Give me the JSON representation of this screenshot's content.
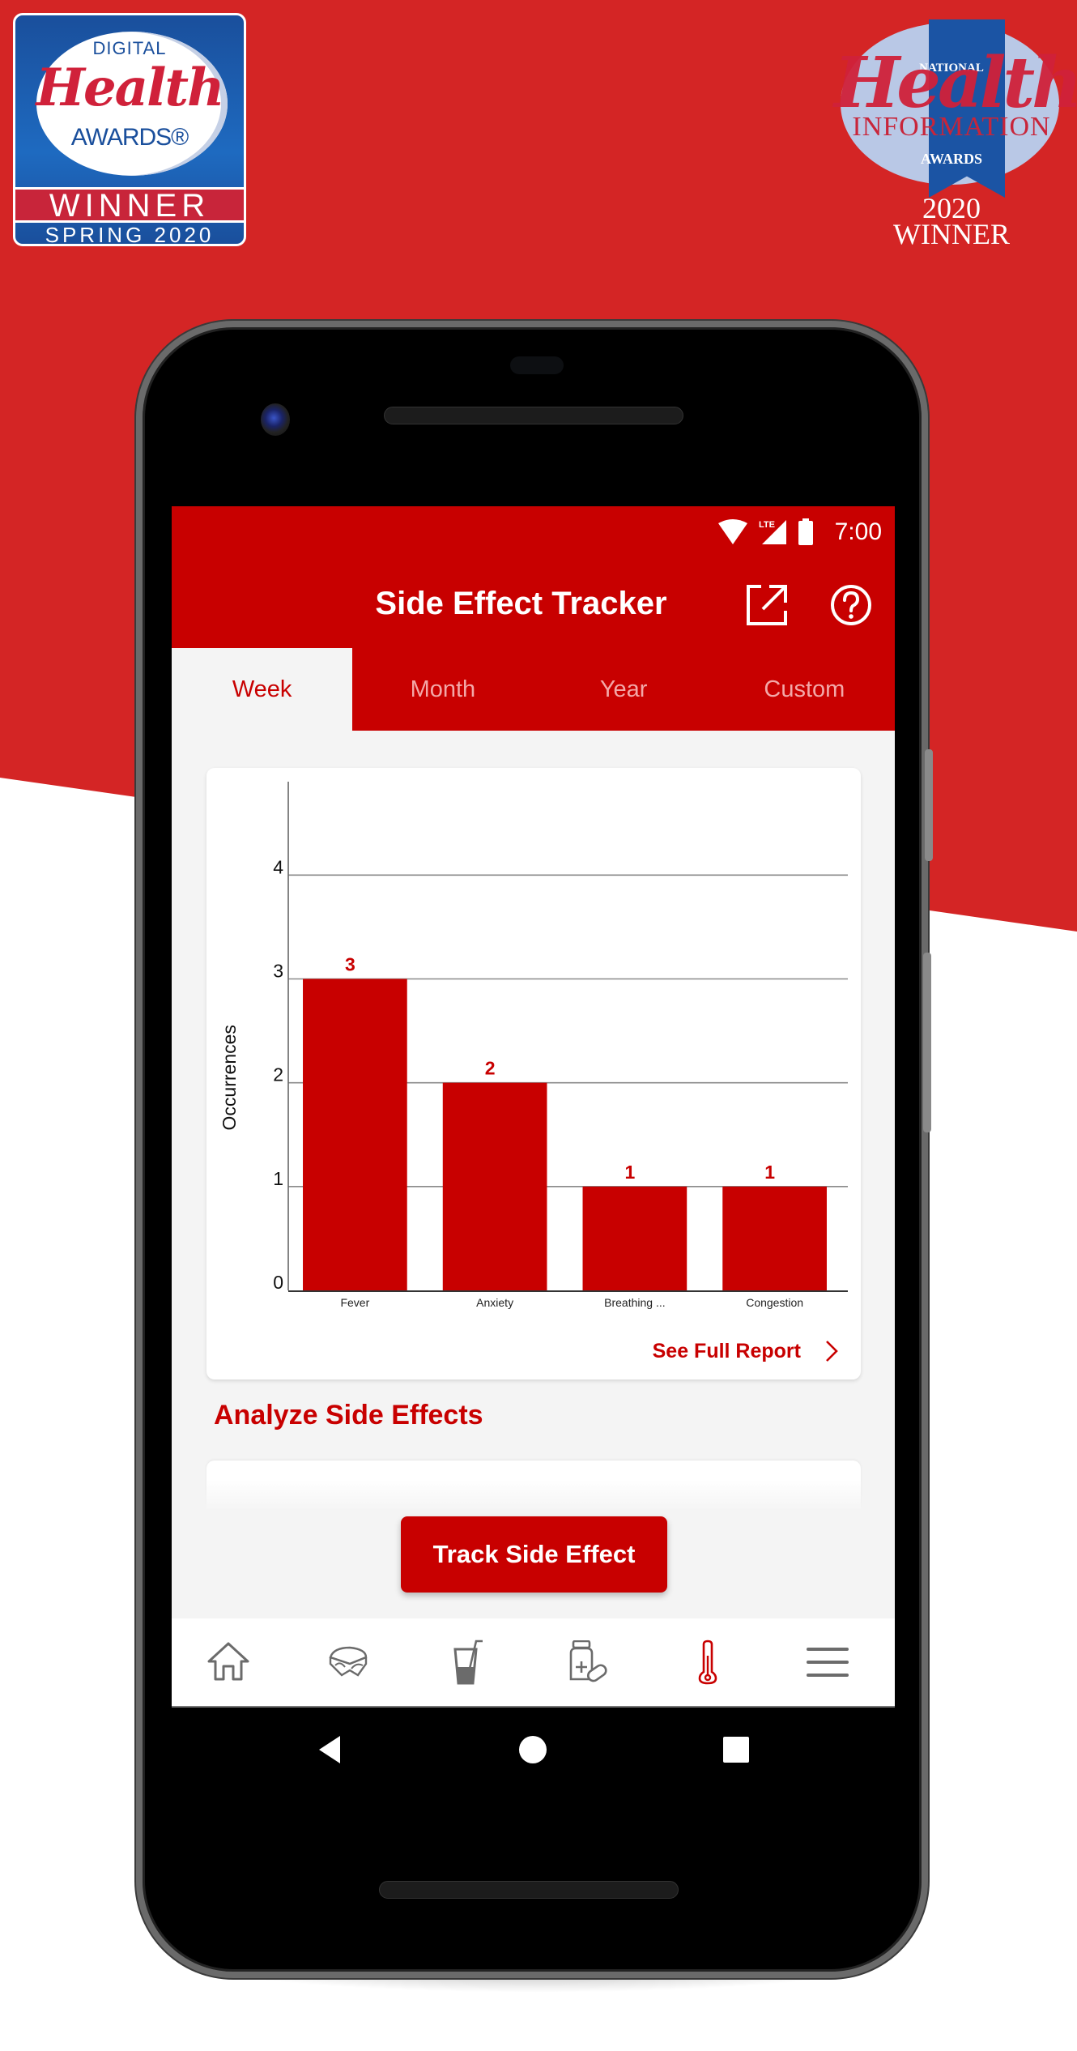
{
  "badges": {
    "left": {
      "line1": "DIGITAL",
      "line2": "Health",
      "line3": "AWARDS®",
      "line4": "WINNER",
      "line5": "SPRING 2020"
    },
    "right": {
      "line1": "NATIONAL",
      "line2": "Health",
      "line3": "INFORMATION",
      "line4": "AWARDS",
      "line5": "2020",
      "line6": "WINNER"
    }
  },
  "status_bar": {
    "time": "7:00",
    "network": "LTE",
    "icons": [
      "wifi-icon",
      "signal-icon",
      "battery-icon"
    ]
  },
  "header": {
    "title": "Side Effect Tracker",
    "actions": [
      {
        "name": "share-icon",
        "label": "Export"
      },
      {
        "name": "help-icon",
        "label": "Help"
      }
    ]
  },
  "tabs": [
    {
      "label": "Week",
      "active": true
    },
    {
      "label": "Month",
      "active": false
    },
    {
      "label": "Year",
      "active": false
    },
    {
      "label": "Custom",
      "active": false
    }
  ],
  "chart_data": {
    "type": "bar",
    "title": "",
    "xlabel": "",
    "ylabel": "Occurrences",
    "categories": [
      "Fever",
      "Anxiety",
      "Breathing ...",
      "Congestion"
    ],
    "values": [
      3,
      2,
      1,
      1
    ],
    "data_labels": [
      "3",
      "2",
      "1",
      "1"
    ],
    "yticks": [
      0,
      1,
      2,
      3,
      4
    ],
    "ylim": [
      0,
      4.9
    ],
    "grid": true,
    "bar_color": "#c80000",
    "label_color": "#c80000",
    "legend": "none"
  },
  "report_link": {
    "label": "See Full Report",
    "icon": "chevron-right-icon"
  },
  "analyze": {
    "title": "Analyze Side Effects"
  },
  "track_button": {
    "label": "Track Side Effect"
  },
  "bottom_nav": [
    {
      "name": "home",
      "icon": "home-icon",
      "active": false
    },
    {
      "name": "food",
      "icon": "sandwich-icon",
      "active": false
    },
    {
      "name": "drink",
      "icon": "drink-icon",
      "active": false
    },
    {
      "name": "medication",
      "icon": "pill-bottle-icon",
      "active": false
    },
    {
      "name": "side-effects",
      "icon": "thermometer-icon",
      "active": true
    },
    {
      "name": "menu",
      "icon": "menu-icon",
      "active": false
    }
  ],
  "colors": {
    "brand": "#c80000",
    "background_red": "#d42525",
    "inactive_tab": "#f3a8a8",
    "nav_icon": "#6b6b6b",
    "content_bg": "#f4f4f4"
  }
}
